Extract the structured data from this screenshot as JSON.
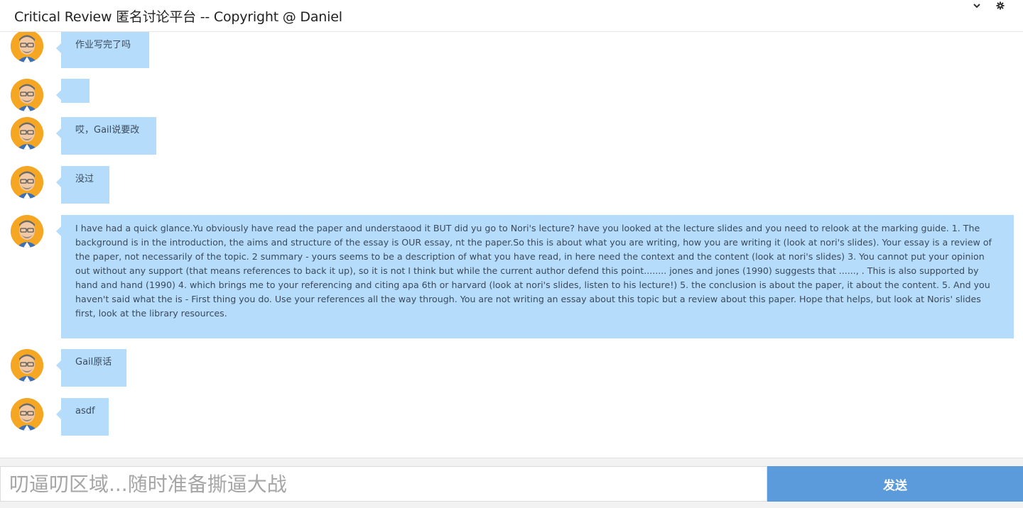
{
  "header": {
    "title": "Critical Review 匿名讨论平台 -- Copyright @ Daniel",
    "icons": [
      "chevron-down-icon",
      "gear-icon"
    ]
  },
  "messages": [
    {
      "text": "作业写完了吗",
      "avatar": "user-avatar"
    },
    {
      "text": "",
      "avatar": "user-avatar"
    },
    {
      "text": "哎，Gail说要改",
      "avatar": "user-avatar"
    },
    {
      "text": "没过",
      "avatar": "user-avatar"
    },
    {
      "text": "I have had a quick glance.Yu obviously have read the paper and understaood it BUT did yu go to Nori's lecture? have you looked at the lecture slides and you need to relook at the marking guide. 1. The background is in the introduction, the aims and structure of the essay is OUR essay, nt the paper.So this is about what you are writing, how you are writing it (look at nori's slides). Your essay is a review of the paper, not necessarily of the topic. 2 summary - yours seems to be a description of what you have read, in here need the context and the content (look at nori's slides) 3. You cannot put your opinion out without any support (that means references to back it up), so it is not I think but while the current author defend this point........ jones and jones (1990) suggests that ......, . This is also supported by hand and hand (1990) 4. which brings me to your referencing and citing apa 6th or harvard (look at nori's slides, listen to his lecture!) 5. the conclusion is about the paper, it about the content. 5. And you haven't said what the is - First thing you do. Use your references all the way through. You are not writing an essay about this topic but a review about this paper. Hope that helps, but look at Noris' slides first, look at the library resources.",
      "avatar": "user-avatar"
    },
    {
      "text": "Gail原话",
      "avatar": "user-avatar"
    },
    {
      "text": "asdf",
      "avatar": "user-avatar"
    }
  ],
  "composer": {
    "placeholder": "叨逼叨区域...随时准备撕逼大战",
    "value": "",
    "send_label": "发送"
  },
  "colors": {
    "bubble": "#b6dcfc",
    "send_button": "#5b9bdc",
    "avatar_bg": "#f5a623"
  }
}
